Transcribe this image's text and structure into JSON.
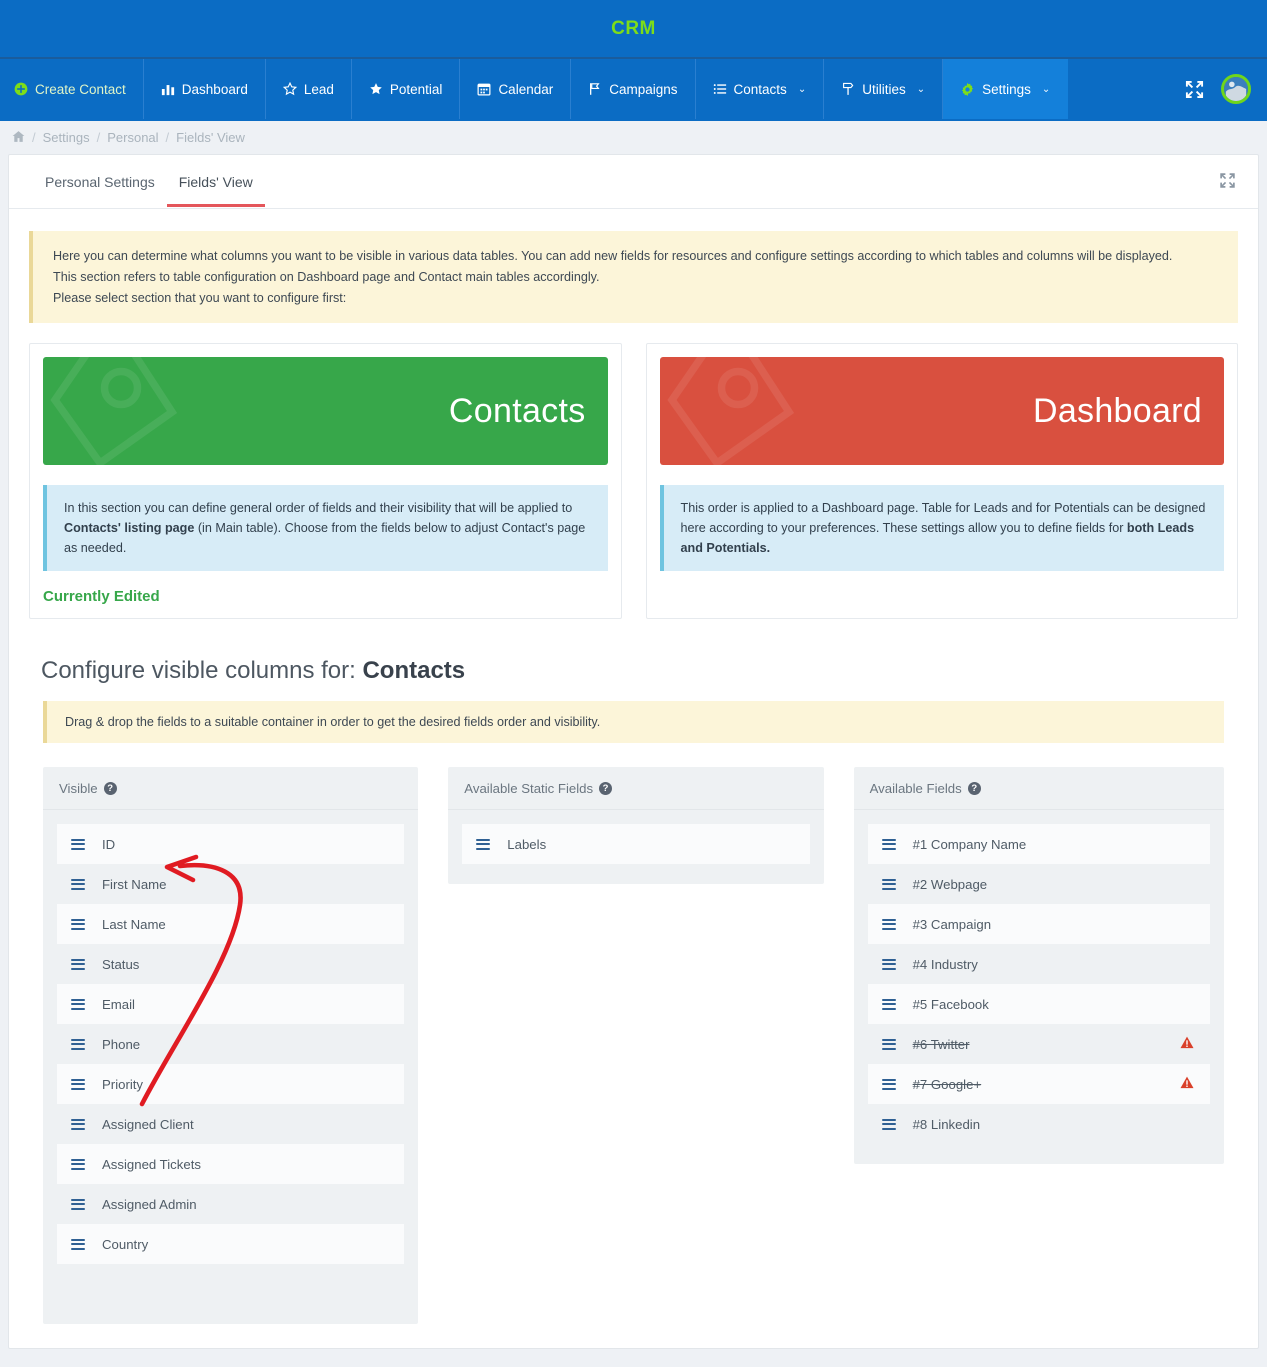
{
  "app": {
    "brand_title": "CRM",
    "accent_blue": "#0b6cc4",
    "accent_green": "#7ddd1a",
    "tab_underline_red": "#e4565b"
  },
  "nav": {
    "items": [
      {
        "label": "Create Contact",
        "icon": "plus-circle-icon",
        "active": false
      },
      {
        "label": "Dashboard",
        "icon": "bar-chart-icon",
        "active": false
      },
      {
        "label": "Lead",
        "icon": "star-outline-icon",
        "active": false
      },
      {
        "label": "Potential",
        "icon": "star-filled-icon",
        "active": false
      },
      {
        "label": "Calendar",
        "icon": "calendar-icon",
        "active": false
      },
      {
        "label": "Campaigns",
        "icon": "flag-icon",
        "active": false
      },
      {
        "label": "Contacts",
        "icon": "list-icon",
        "caret": "⌄",
        "active": false
      },
      {
        "label": "Utilities",
        "icon": "signpost-icon",
        "caret": "⌄",
        "active": false
      },
      {
        "label": "Settings",
        "icon": "gear-icon",
        "caret": "⌄",
        "active": true
      }
    ],
    "expand_icon": "fullscreen-expand-icon",
    "avatar": "user-avatar"
  },
  "breadcrumb": {
    "home_icon": "home-icon",
    "items": [
      "Settings",
      "Personal",
      "Fields' View"
    ],
    "separator": "/"
  },
  "tabs": [
    {
      "label": "Personal Settings",
      "active": false
    },
    {
      "label": "Fields' View",
      "active": true
    }
  ],
  "card": {
    "expand_icon": "fullscreen-expand-icon"
  },
  "banner": {
    "line1": "Here you can determine what columns you want to be visible in various data tables. You can add new fields for resources and configure settings according to which tables and columns will be displayed.",
    "line2": "This section refers to table configuration on Dashboard page and Contact main tables accordingly.",
    "line3": "Please select section that you want to configure first:"
  },
  "sections": {
    "contacts": {
      "hero_title": "Contacts",
      "hero_color": "#37a74a",
      "desc_prefix": "In this section you can define general order of fields and their visibility that will be applied to ",
      "desc_bold": "Contacts' listing page",
      "desc_suffix": " (in Main table). Choose from the fields below to adjust Contact's page as needed.",
      "status": "Currently Edited"
    },
    "dashboard": {
      "hero_title": "Dashboard",
      "hero_color": "#d9503f",
      "desc_prefix": "This order is applied to a Dashboard page. Table for Leads and for Potentials can be designed here according to your preferences. These settings allow you to define fields for ",
      "desc_bold": "both Leads and Potentials.",
      "desc_suffix": ""
    }
  },
  "configure": {
    "title_prefix": "Configure visible columns for: ",
    "title_target": "Contacts",
    "hint": "Drag & drop the fields to a suitable container in order to get the desired fields order and visibility."
  },
  "panels": {
    "visible": {
      "title": "Visible",
      "help": "?",
      "items": [
        {
          "label": "ID",
          "struck": false,
          "warning": false
        },
        {
          "label": "First Name",
          "struck": false,
          "warning": false
        },
        {
          "label": "Last Name",
          "struck": false,
          "warning": false
        },
        {
          "label": "Status",
          "struck": false,
          "warning": false
        },
        {
          "label": "Email",
          "struck": false,
          "warning": false
        },
        {
          "label": "Phone",
          "struck": false,
          "warning": false
        },
        {
          "label": "Priority",
          "struck": false,
          "warning": false
        },
        {
          "label": "Assigned Client",
          "struck": false,
          "warning": false
        },
        {
          "label": "Assigned Tickets",
          "struck": false,
          "warning": false
        },
        {
          "label": "Assigned Admin",
          "struck": false,
          "warning": false
        },
        {
          "label": "Country",
          "struck": false,
          "warning": false
        }
      ]
    },
    "static": {
      "title": "Available Static Fields",
      "help": "?",
      "items": [
        {
          "label": "Labels",
          "struck": false,
          "warning": false
        }
      ]
    },
    "available": {
      "title": "Available Fields",
      "help": "?",
      "items": [
        {
          "label": "#1 Company Name",
          "struck": false,
          "warning": false
        },
        {
          "label": "#2 Webpage",
          "struck": false,
          "warning": false
        },
        {
          "label": "#3 Campaign",
          "struck": false,
          "warning": false
        },
        {
          "label": "#4 Industry",
          "struck": false,
          "warning": false
        },
        {
          "label": "#5 Facebook",
          "struck": false,
          "warning": false
        },
        {
          "label": "#6 Twitter",
          "struck": true,
          "warning": true
        },
        {
          "label": "#7 Google+",
          "struck": true,
          "warning": true
        },
        {
          "label": "#8 Linkedin",
          "struck": false,
          "warning": false
        }
      ]
    }
  },
  "annotation": {
    "arrow_color": "#e01b22",
    "description": "red curved arrow pointing from Priority row up to ID row"
  }
}
